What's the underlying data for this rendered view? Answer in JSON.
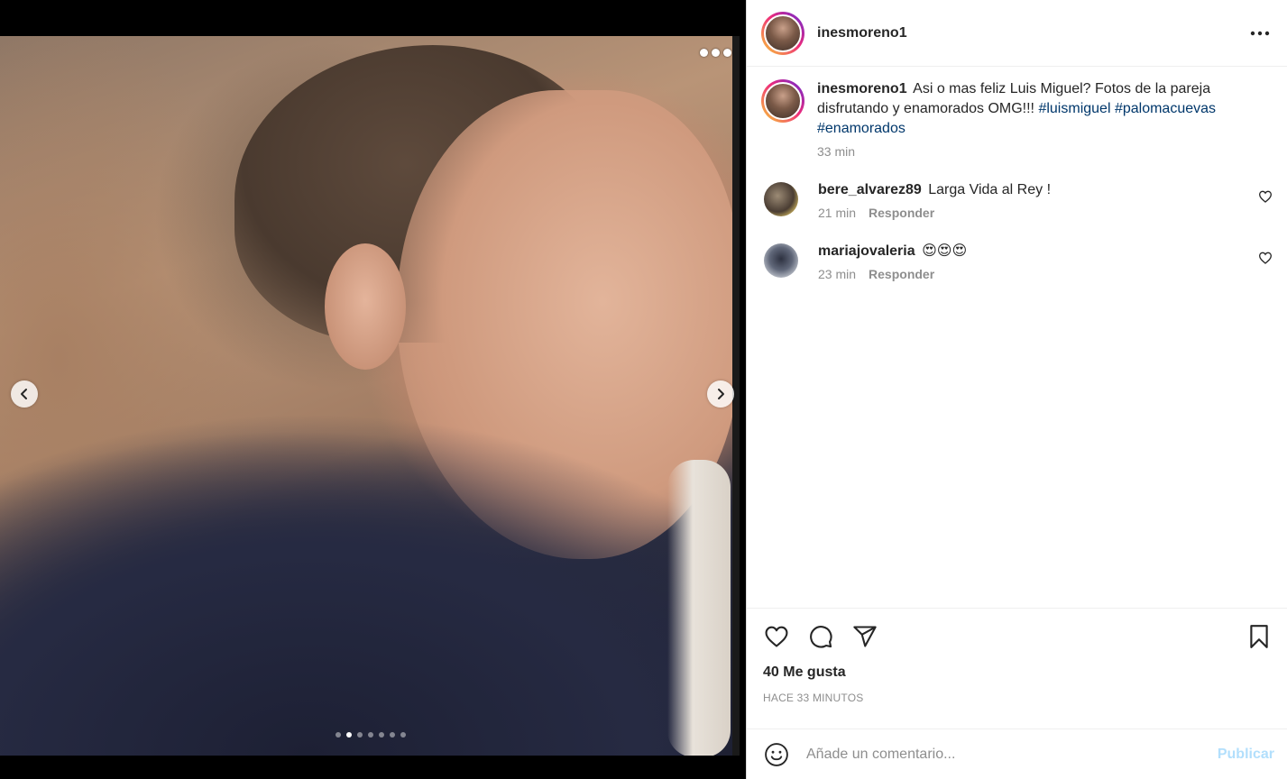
{
  "post": {
    "author": "inesmoreno1",
    "caption": {
      "username": "inesmoreno1",
      "text": "Asi o mas feliz Luis Miguel? Fotos de la pareja disfrutando y enamorados OMG!!! ",
      "hashtags": [
        "#luismiguel",
        "#palomacuevas",
        "#enamorados"
      ],
      "time": "33 min"
    },
    "carousel": {
      "total": 7,
      "active_index": 1
    },
    "comments": [
      {
        "username": "bere_alvarez89",
        "text": "Larga Vida al Rey !",
        "time": "21 min",
        "reply": "Responder"
      },
      {
        "username": "mariajovaleria",
        "text": "😍😍😍",
        "time": "23 min",
        "reply": "Responder"
      }
    ],
    "likes": "40 Me gusta",
    "posted_ago": "HACE 33 MINUTOS",
    "add_comment": {
      "placeholder": "Añade un comentario...",
      "publish_label": "Publicar"
    }
  },
  "icons": {
    "more": "more-horizontal-icon",
    "prev": "chevron-left-icon",
    "next": "chevron-right-icon",
    "like": "heart-icon",
    "comment": "comment-bubble-icon",
    "share": "paper-plane-icon",
    "save": "bookmark-icon",
    "emoji": "emoji-smile-icon"
  },
  "colors": {
    "hashtag": "#00376b",
    "secondary_text": "#8e8e8e",
    "publish_disabled": "#b2dffc"
  }
}
